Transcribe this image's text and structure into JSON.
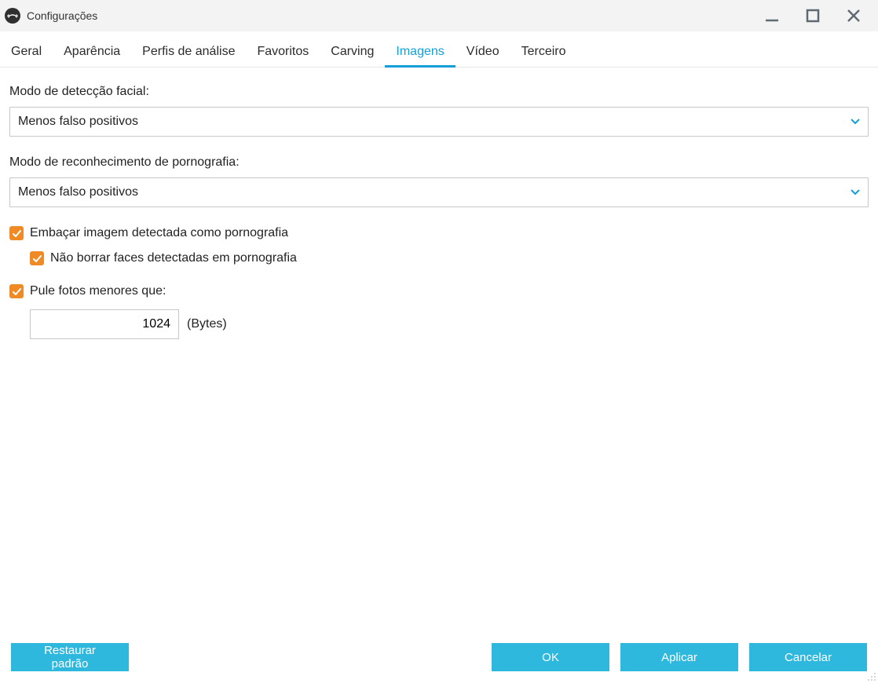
{
  "window": {
    "title": "Configurações"
  },
  "tabs": [
    {
      "label": "Geral",
      "active": false
    },
    {
      "label": "Aparência",
      "active": false
    },
    {
      "label": "Perfis de análise",
      "active": false
    },
    {
      "label": "Favoritos",
      "active": false
    },
    {
      "label": "Carving",
      "active": false
    },
    {
      "label": "Imagens",
      "active": true
    },
    {
      "label": "Vídeo",
      "active": false
    },
    {
      "label": "Terceiro",
      "active": false
    }
  ],
  "form": {
    "facial_detection": {
      "label": "Modo de detecção facial:",
      "value": "Menos falso positivos"
    },
    "porn_recognition": {
      "label": "Modo de reconhecimento de pornografia:",
      "value": "Menos falso positivos"
    },
    "blur_porn": {
      "label": "Embaçar imagem detectada como pornografia",
      "checked": true
    },
    "dont_blur_faces": {
      "label": "Não borrar faces detectadas em pornografia",
      "checked": true
    },
    "skip_small": {
      "label": "Pule fotos menores que:",
      "checked": true,
      "value": "1024",
      "unit": "(Bytes)"
    }
  },
  "footer": {
    "restore": "Restaurar padrão",
    "ok": "OK",
    "apply": "Aplicar",
    "cancel": "Cancelar"
  }
}
